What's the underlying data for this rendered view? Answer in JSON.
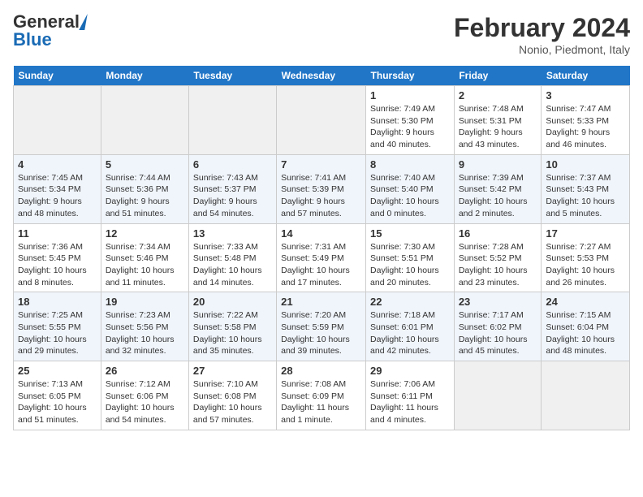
{
  "header": {
    "logo_line1": "General",
    "logo_line2": "Blue",
    "month_title": "February 2024",
    "location": "Nonio, Piedmont, Italy"
  },
  "columns": [
    "Sunday",
    "Monday",
    "Tuesday",
    "Wednesday",
    "Thursday",
    "Friday",
    "Saturday"
  ],
  "weeks": [
    [
      {
        "day": "",
        "empty": true
      },
      {
        "day": "",
        "empty": true
      },
      {
        "day": "",
        "empty": true
      },
      {
        "day": "",
        "empty": true
      },
      {
        "day": "1",
        "sunrise": "7:49 AM",
        "sunset": "5:30 PM",
        "daylight": "9 hours and 40 minutes."
      },
      {
        "day": "2",
        "sunrise": "7:48 AM",
        "sunset": "5:31 PM",
        "daylight": "9 hours and 43 minutes."
      },
      {
        "day": "3",
        "sunrise": "7:47 AM",
        "sunset": "5:33 PM",
        "daylight": "9 hours and 46 minutes."
      }
    ],
    [
      {
        "day": "4",
        "sunrise": "7:45 AM",
        "sunset": "5:34 PM",
        "daylight": "9 hours and 48 minutes."
      },
      {
        "day": "5",
        "sunrise": "7:44 AM",
        "sunset": "5:36 PM",
        "daylight": "9 hours and 51 minutes."
      },
      {
        "day": "6",
        "sunrise": "7:43 AM",
        "sunset": "5:37 PM",
        "daylight": "9 hours and 54 minutes."
      },
      {
        "day": "7",
        "sunrise": "7:41 AM",
        "sunset": "5:39 PM",
        "daylight": "9 hours and 57 minutes."
      },
      {
        "day": "8",
        "sunrise": "7:40 AM",
        "sunset": "5:40 PM",
        "daylight": "10 hours and 0 minutes."
      },
      {
        "day": "9",
        "sunrise": "7:39 AM",
        "sunset": "5:42 PM",
        "daylight": "10 hours and 2 minutes."
      },
      {
        "day": "10",
        "sunrise": "7:37 AM",
        "sunset": "5:43 PM",
        "daylight": "10 hours and 5 minutes."
      }
    ],
    [
      {
        "day": "11",
        "sunrise": "7:36 AM",
        "sunset": "5:45 PM",
        "daylight": "10 hours and 8 minutes."
      },
      {
        "day": "12",
        "sunrise": "7:34 AM",
        "sunset": "5:46 PM",
        "daylight": "10 hours and 11 minutes."
      },
      {
        "day": "13",
        "sunrise": "7:33 AM",
        "sunset": "5:48 PM",
        "daylight": "10 hours and 14 minutes."
      },
      {
        "day": "14",
        "sunrise": "7:31 AM",
        "sunset": "5:49 PM",
        "daylight": "10 hours and 17 minutes."
      },
      {
        "day": "15",
        "sunrise": "7:30 AM",
        "sunset": "5:51 PM",
        "daylight": "10 hours and 20 minutes."
      },
      {
        "day": "16",
        "sunrise": "7:28 AM",
        "sunset": "5:52 PM",
        "daylight": "10 hours and 23 minutes."
      },
      {
        "day": "17",
        "sunrise": "7:27 AM",
        "sunset": "5:53 PM",
        "daylight": "10 hours and 26 minutes."
      }
    ],
    [
      {
        "day": "18",
        "sunrise": "7:25 AM",
        "sunset": "5:55 PM",
        "daylight": "10 hours and 29 minutes."
      },
      {
        "day": "19",
        "sunrise": "7:23 AM",
        "sunset": "5:56 PM",
        "daylight": "10 hours and 32 minutes."
      },
      {
        "day": "20",
        "sunrise": "7:22 AM",
        "sunset": "5:58 PM",
        "daylight": "10 hours and 35 minutes."
      },
      {
        "day": "21",
        "sunrise": "7:20 AM",
        "sunset": "5:59 PM",
        "daylight": "10 hours and 39 minutes."
      },
      {
        "day": "22",
        "sunrise": "7:18 AM",
        "sunset": "6:01 PM",
        "daylight": "10 hours and 42 minutes."
      },
      {
        "day": "23",
        "sunrise": "7:17 AM",
        "sunset": "6:02 PM",
        "daylight": "10 hours and 45 minutes."
      },
      {
        "day": "24",
        "sunrise": "7:15 AM",
        "sunset": "6:04 PM",
        "daylight": "10 hours and 48 minutes."
      }
    ],
    [
      {
        "day": "25",
        "sunrise": "7:13 AM",
        "sunset": "6:05 PM",
        "daylight": "10 hours and 51 minutes."
      },
      {
        "day": "26",
        "sunrise": "7:12 AM",
        "sunset": "6:06 PM",
        "daylight": "10 hours and 54 minutes."
      },
      {
        "day": "27",
        "sunrise": "7:10 AM",
        "sunset": "6:08 PM",
        "daylight": "10 hours and 57 minutes."
      },
      {
        "day": "28",
        "sunrise": "7:08 AM",
        "sunset": "6:09 PM",
        "daylight": "11 hours and 1 minute."
      },
      {
        "day": "29",
        "sunrise": "7:06 AM",
        "sunset": "6:11 PM",
        "daylight": "11 hours and 4 minutes."
      },
      {
        "day": "",
        "empty": true
      },
      {
        "day": "",
        "empty": true
      }
    ]
  ],
  "labels": {
    "sunrise_prefix": "Sunrise: ",
    "sunset_prefix": "Sunset: ",
    "daylight_prefix": "Daylight: "
  }
}
